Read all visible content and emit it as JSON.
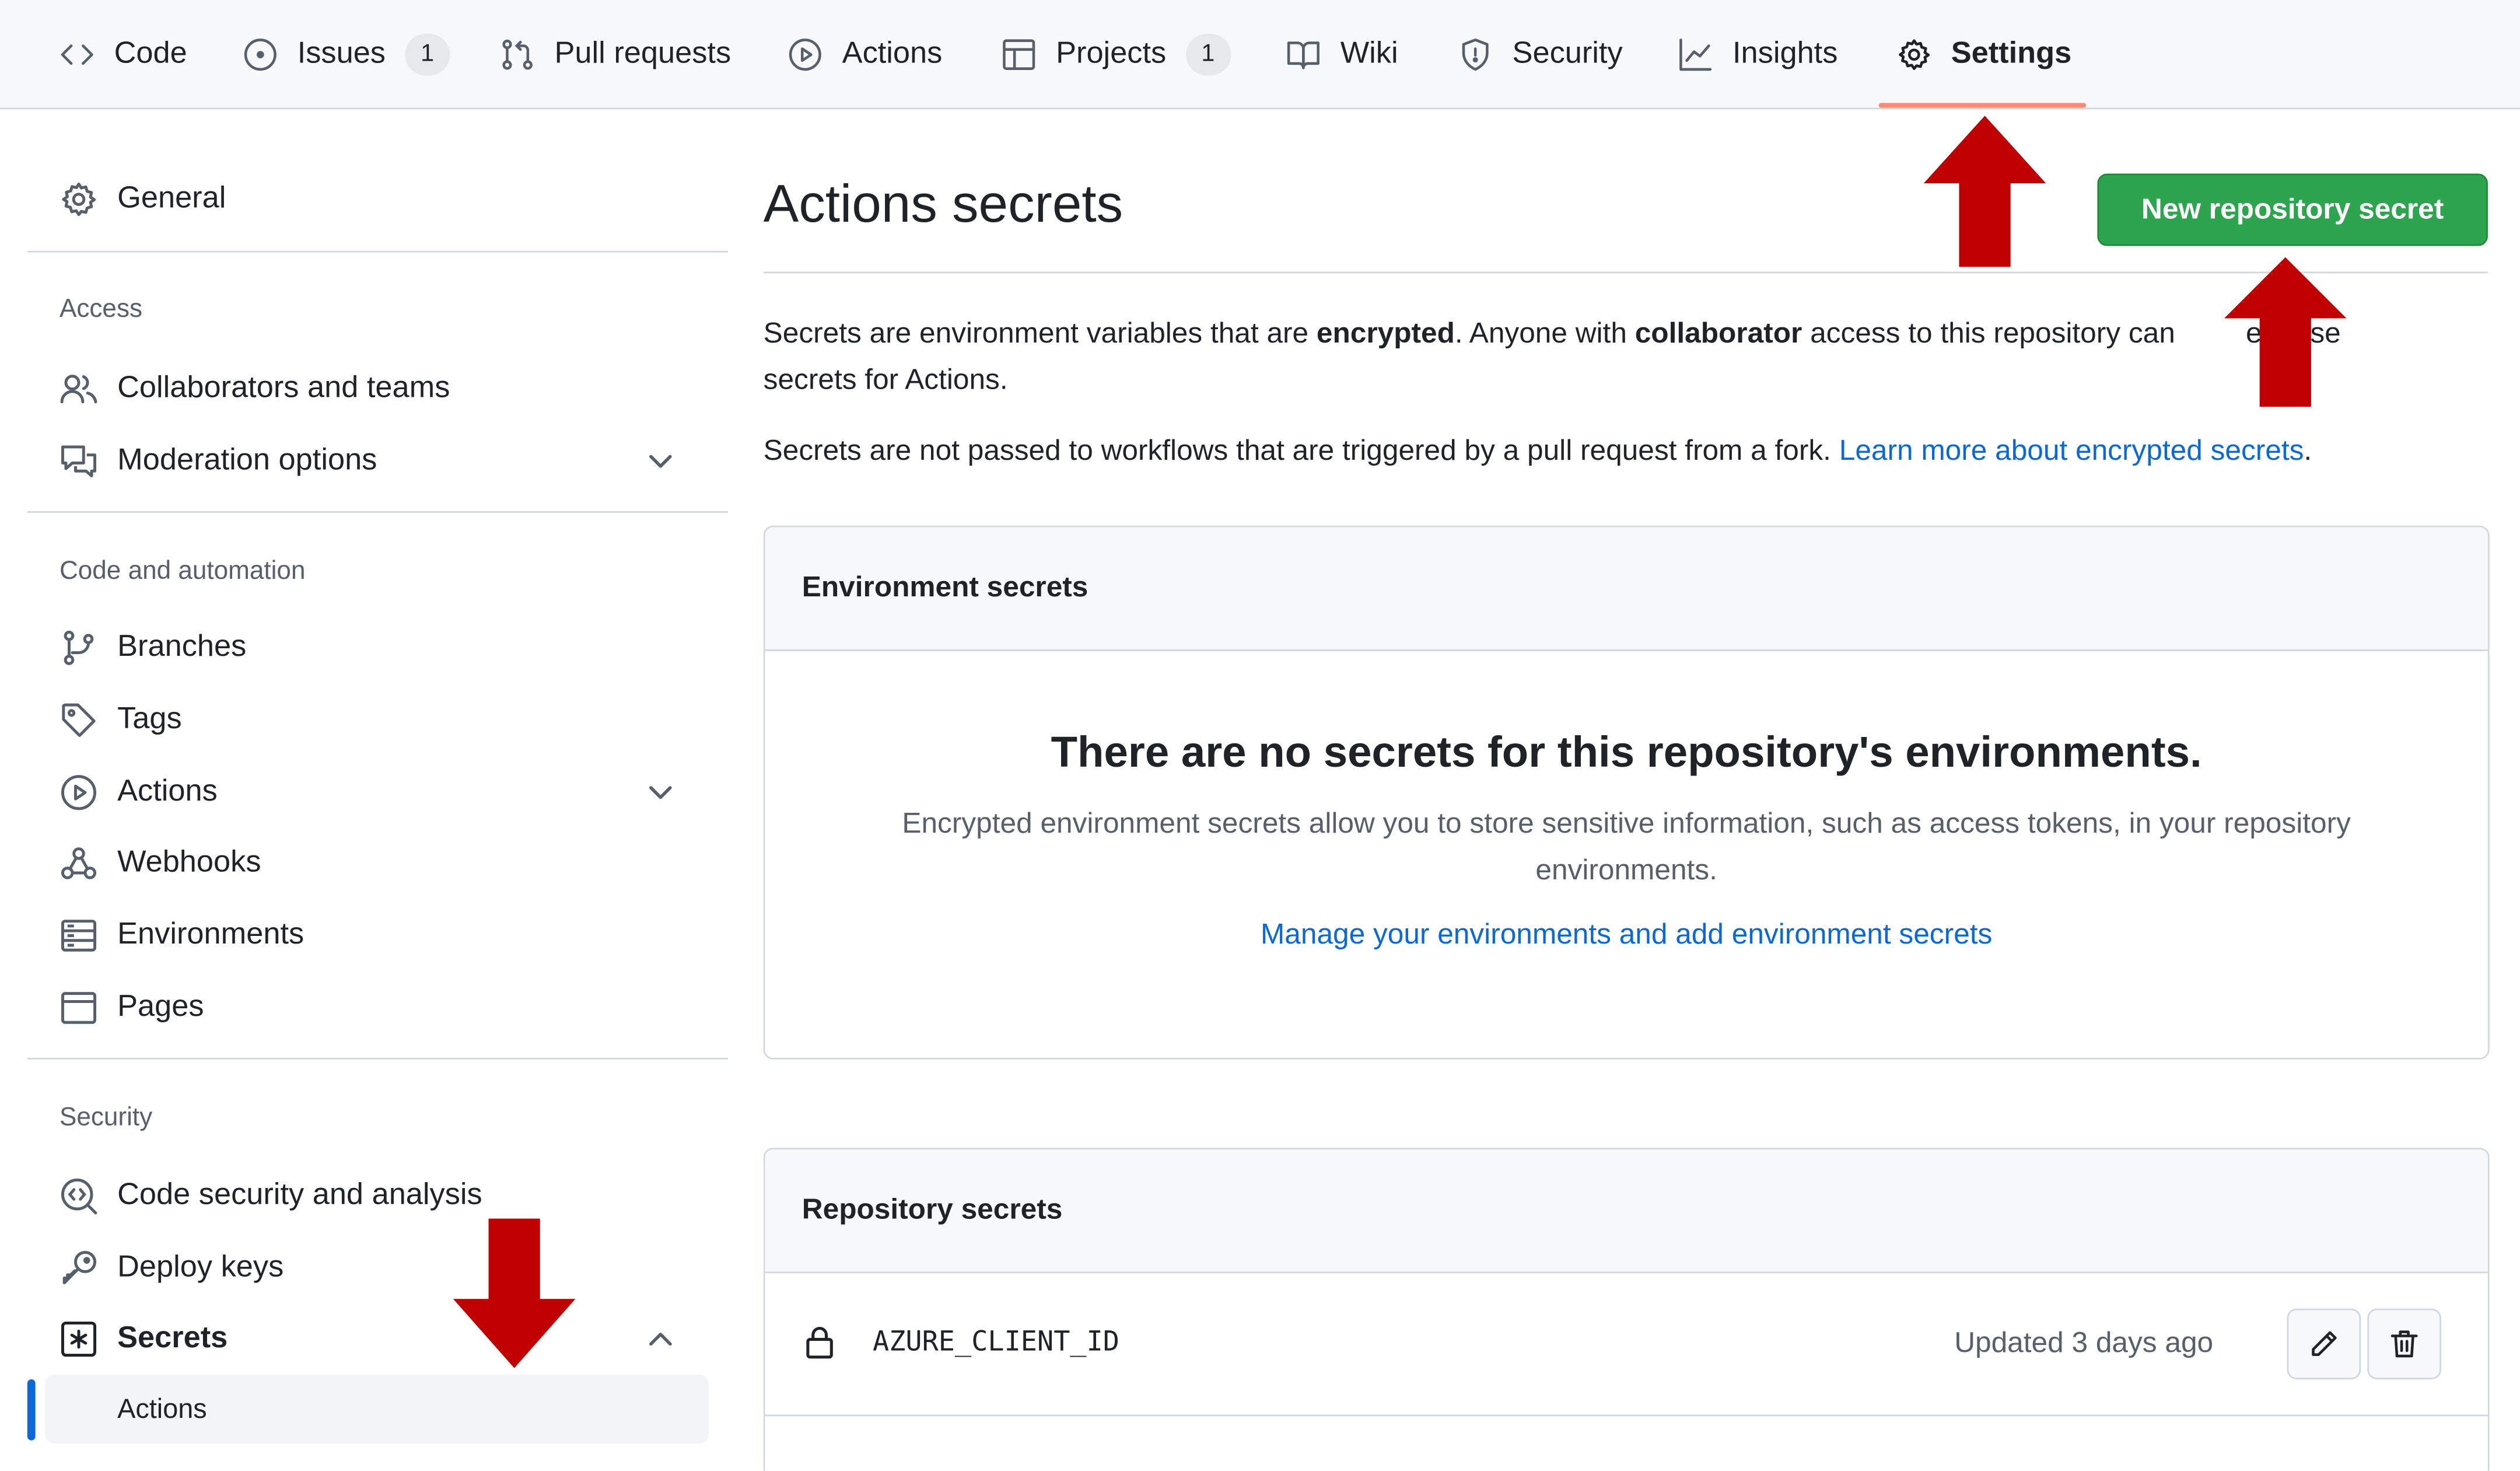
{
  "topnav": {
    "tabs": [
      {
        "label": "Code",
        "icon": "code-icon"
      },
      {
        "label": "Issues",
        "icon": "issue-opened-icon",
        "count": "1"
      },
      {
        "label": "Pull requests",
        "icon": "git-pull-request-icon"
      },
      {
        "label": "Actions",
        "icon": "play-icon"
      },
      {
        "label": "Projects",
        "icon": "table-icon",
        "count": "1"
      },
      {
        "label": "Wiki",
        "icon": "book-icon"
      },
      {
        "label": "Security",
        "icon": "shield-icon"
      },
      {
        "label": "Insights",
        "icon": "graph-icon"
      },
      {
        "label": "Settings",
        "icon": "gear-icon",
        "selected": true
      }
    ]
  },
  "sidebar": {
    "general": "General",
    "sections": [
      {
        "heading": "Access",
        "items": [
          "Collaborators and teams",
          "Moderation options"
        ]
      },
      {
        "heading": "Code and automation",
        "items": [
          "Branches",
          "Tags",
          "Actions",
          "Webhooks",
          "Environments",
          "Pages"
        ]
      },
      {
        "heading": "Security",
        "items": [
          "Code security and analysis",
          "Deploy keys",
          "Secrets"
        ]
      }
    ],
    "secrets_subitem": "Actions"
  },
  "main": {
    "title": "Actions secrets",
    "new_secret_button": "New repository secret",
    "intro": {
      "p1_a": "Secrets are environment variables that are ",
      "p1_b": "encrypted",
      "p1_c": ". Anyone with ",
      "p1_d": "collaborator",
      "p1_e": " access to this repository can",
      "p1_f": "e these",
      "p1_g": "secrets for Actions.",
      "p2": "Secrets are not passed to workflows that are triggered by a pull request from a fork. ",
      "p2_link": "Learn more about encrypted secrets",
      "p2_end": "."
    },
    "environment_secrets": {
      "title": "Environment secrets",
      "empty_title": "There are no secrets for this repository's environments.",
      "empty_desc_1": "Encrypted environment secrets allow you to store sensitive information, such as access tokens, in your repository",
      "empty_desc_2": "environments.",
      "manage_link": "Manage your environments and add environment secrets"
    },
    "repository_secrets": {
      "title": "Repository secrets",
      "rows": [
        {
          "name": "AZURE_CLIENT_ID",
          "updated": "Updated 3 days ago"
        }
      ]
    }
  },
  "colors": {
    "accent_green": "#2da44e",
    "link_blue": "#0969da",
    "selected_underline": "#fd8c73",
    "annotation_arrow": "#c00000"
  }
}
